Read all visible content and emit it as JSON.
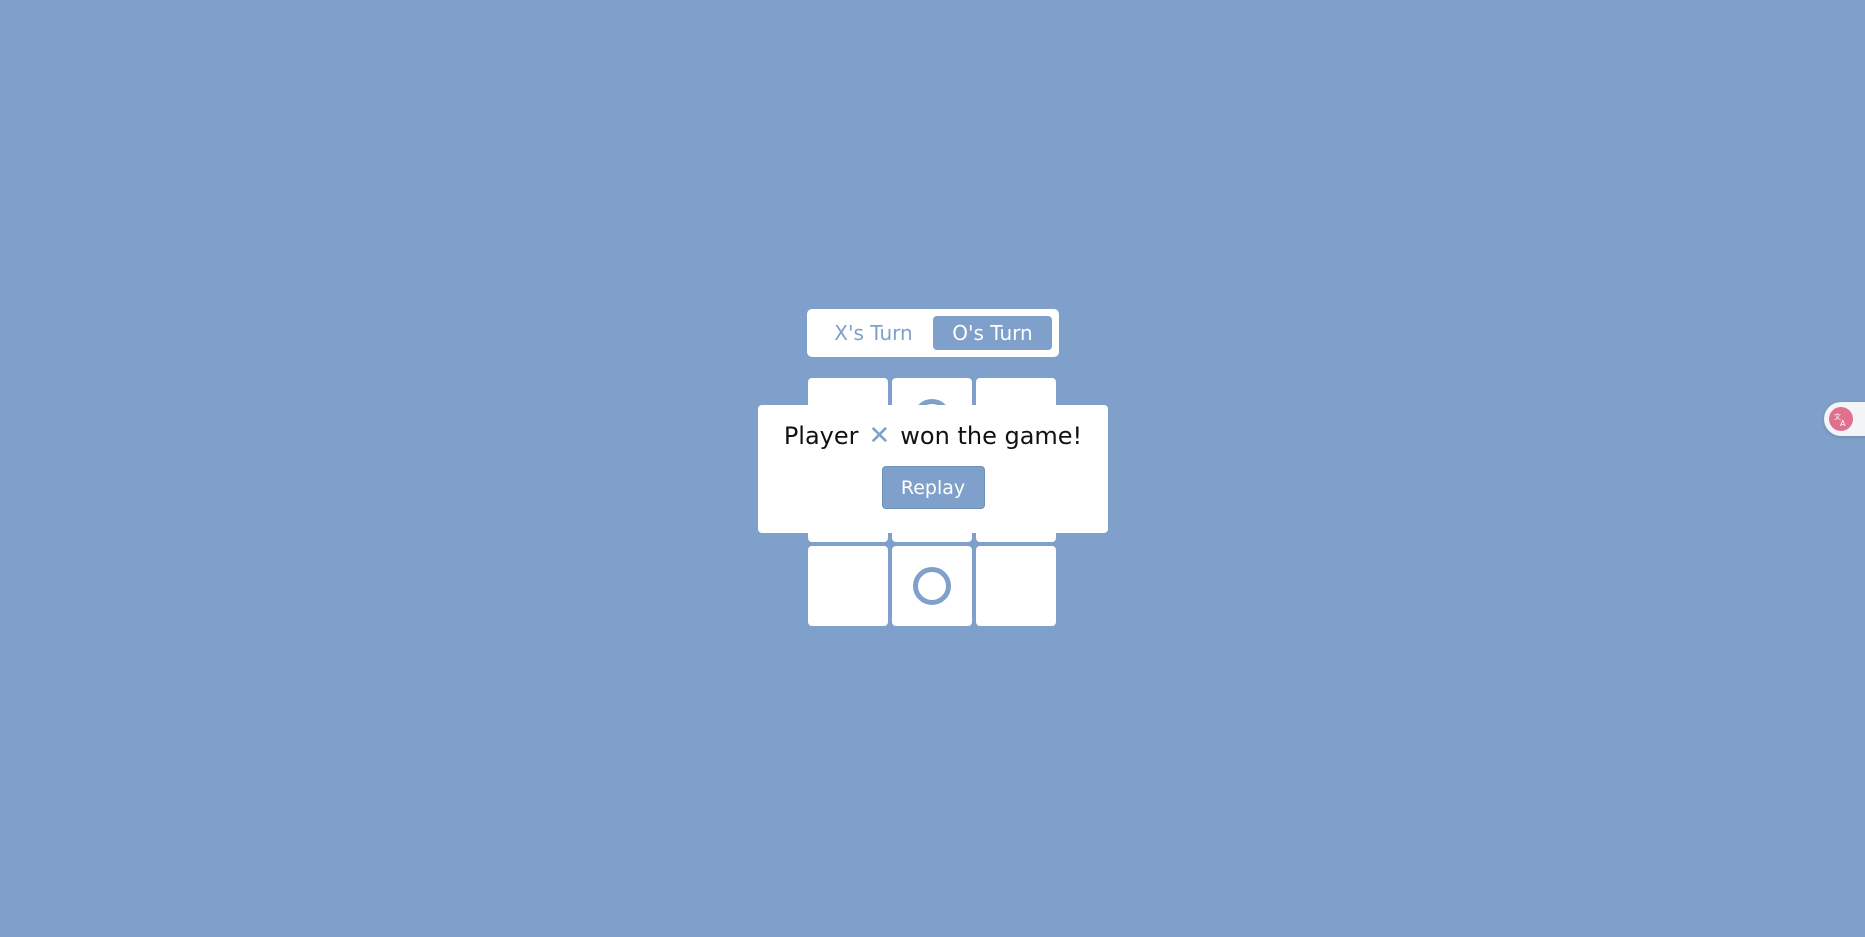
{
  "colors": {
    "background": "#7fa0ca",
    "accent": "#7fa0ca",
    "surface": "#ffffff",
    "text": "#111111",
    "translate_badge": "#e0708e"
  },
  "turn_selector": {
    "x_label": "X's Turn",
    "o_label": "O's Turn",
    "active": "O"
  },
  "board": {
    "cells": [
      "",
      "O",
      "",
      "",
      "",
      "",
      "",
      "O",
      ""
    ]
  },
  "result": {
    "prefix": "Player",
    "winner": "✕",
    "suffix": "won the game!",
    "replay_label": "Replay"
  },
  "translate_widget": {
    "icon": "translate-icon"
  }
}
